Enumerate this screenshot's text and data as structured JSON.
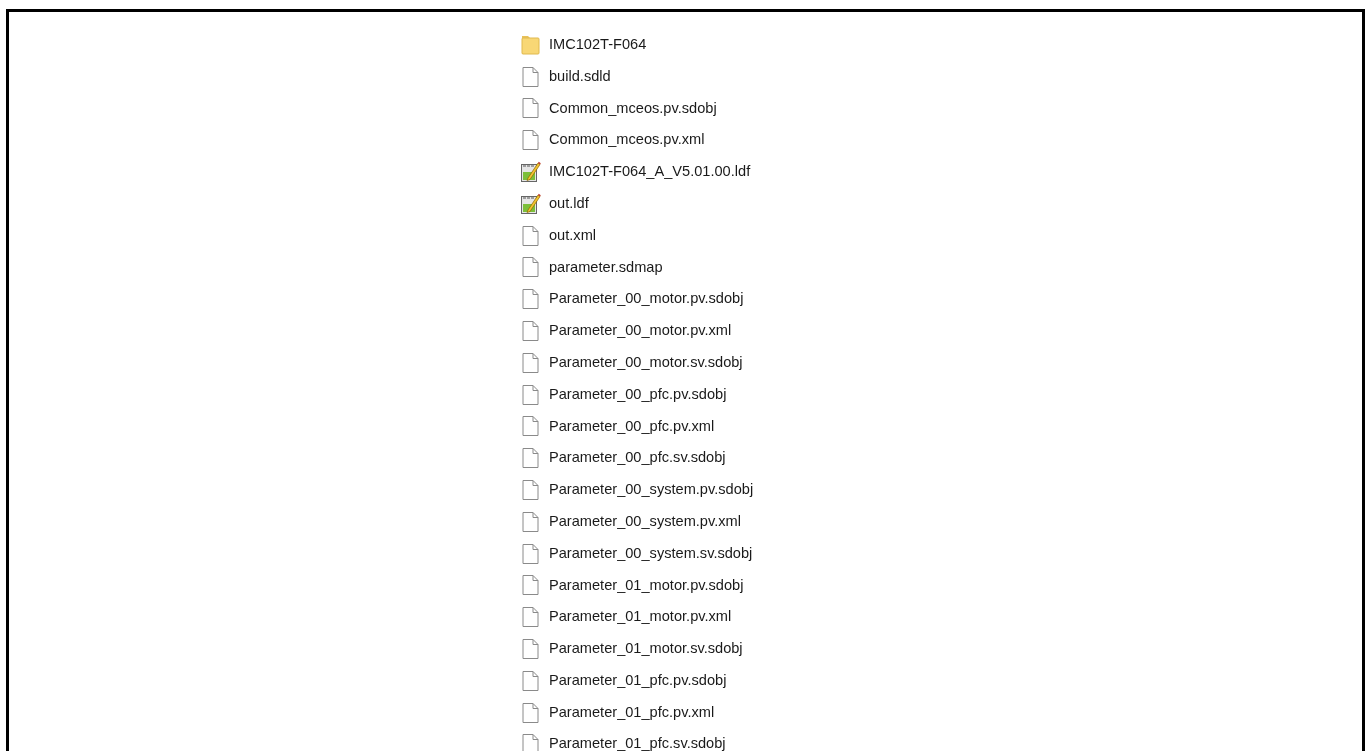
{
  "files": [
    {
      "name": "IMC102T-F064",
      "kind": "folder"
    },
    {
      "name": "build.sdld",
      "kind": "file"
    },
    {
      "name": "Common_mceos.pv.sdobj",
      "kind": "file"
    },
    {
      "name": "Common_mceos.pv.xml",
      "kind": "file"
    },
    {
      "name": "IMC102T-F064_A_V5.01.00.ldf",
      "kind": "edit"
    },
    {
      "name": "out.ldf",
      "kind": "edit"
    },
    {
      "name": "out.xml",
      "kind": "file"
    },
    {
      "name": "parameter.sdmap",
      "kind": "file"
    },
    {
      "name": "Parameter_00_motor.pv.sdobj",
      "kind": "file"
    },
    {
      "name": "Parameter_00_motor.pv.xml",
      "kind": "file"
    },
    {
      "name": "Parameter_00_motor.sv.sdobj",
      "kind": "file"
    },
    {
      "name": "Parameter_00_pfc.pv.sdobj",
      "kind": "file"
    },
    {
      "name": "Parameter_00_pfc.pv.xml",
      "kind": "file"
    },
    {
      "name": "Parameter_00_pfc.sv.sdobj",
      "kind": "file"
    },
    {
      "name": "Parameter_00_system.pv.sdobj",
      "kind": "file"
    },
    {
      "name": "Parameter_00_system.pv.xml",
      "kind": "file"
    },
    {
      "name": "Parameter_00_system.sv.sdobj",
      "kind": "file"
    },
    {
      "name": "Parameter_01_motor.pv.sdobj",
      "kind": "file"
    },
    {
      "name": "Parameter_01_motor.pv.xml",
      "kind": "file"
    },
    {
      "name": "Parameter_01_motor.sv.sdobj",
      "kind": "file"
    },
    {
      "name": "Parameter_01_pfc.pv.sdobj",
      "kind": "file"
    },
    {
      "name": "Parameter_01_pfc.pv.xml",
      "kind": "file"
    },
    {
      "name": "Parameter_01_pfc.sv.sdobj",
      "kind": "file"
    }
  ]
}
